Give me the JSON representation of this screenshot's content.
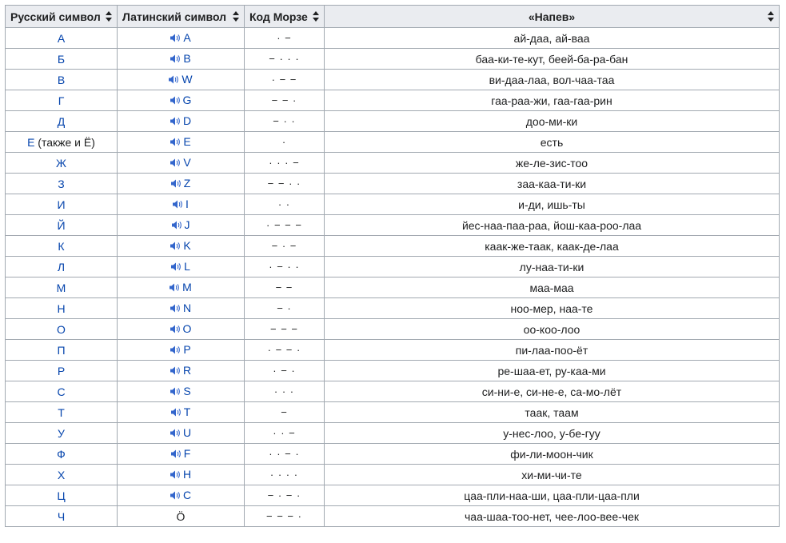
{
  "table": {
    "headers": [
      "Русский символ",
      "Латинский символ",
      "Код Морзе",
      "«Напев»"
    ],
    "rows": [
      {
        "ru": "А",
        "ru_extra": "",
        "lat": "A",
        "audio": true,
        "morse": "· −",
        "chant": "ай-даа, ай-ваа"
      },
      {
        "ru": "Б",
        "ru_extra": "",
        "lat": "B",
        "audio": true,
        "morse": "− · · ·",
        "chant": "баа-ки-те-кут, беей-ба-ра-бан"
      },
      {
        "ru": "В",
        "ru_extra": "",
        "lat": "W",
        "audio": true,
        "morse": "· − −",
        "chant": "ви-даа-лаа, вол-чаа-таа"
      },
      {
        "ru": "Г",
        "ru_extra": "",
        "lat": "G",
        "audio": true,
        "morse": "− − ·",
        "chant": "гаа-раа-жи, гаа-гаа-рин"
      },
      {
        "ru": "Д",
        "ru_extra": "",
        "lat": "D",
        "audio": true,
        "morse": "− · ·",
        "chant": "доо-ми-ки"
      },
      {
        "ru": "Е",
        "ru_extra": " (также и Ё)",
        "lat": "E",
        "audio": true,
        "morse": "·",
        "chant": "есть"
      },
      {
        "ru": "Ж",
        "ru_extra": "",
        "lat": "V",
        "audio": true,
        "morse": "· · · −",
        "chant": "же-ле-зис-тоо"
      },
      {
        "ru": "З",
        "ru_extra": "",
        "lat": "Z",
        "audio": true,
        "morse": "− − · ·",
        "chant": "заа-каа-ти-ки"
      },
      {
        "ru": "И",
        "ru_extra": "",
        "lat": "I",
        "audio": true,
        "morse": "· ·",
        "chant": "и-ди, ишь-ты"
      },
      {
        "ru": "Й",
        "ru_extra": "",
        "lat": "J",
        "audio": true,
        "morse": "· − − −",
        "chant": "йес-наа-паа-раа, йош-каа-роо-лаа"
      },
      {
        "ru": "К",
        "ru_extra": "",
        "lat": "K",
        "audio": true,
        "morse": "− · −",
        "chant": "каак-же-таак, каак-де-лаа"
      },
      {
        "ru": "Л",
        "ru_extra": "",
        "lat": "L",
        "audio": true,
        "morse": "· − · ·",
        "chant": "лу-наа-ти-ки"
      },
      {
        "ru": "М",
        "ru_extra": "",
        "lat": "M",
        "audio": true,
        "morse": "− −",
        "chant": "маа-маа"
      },
      {
        "ru": "Н",
        "ru_extra": "",
        "lat": "N",
        "audio": true,
        "morse": "− ·",
        "chant": "ноо-мер, наа-те"
      },
      {
        "ru": "О",
        "ru_extra": "",
        "lat": "O",
        "audio": true,
        "morse": "− − −",
        "chant": "оо-коо-лоо"
      },
      {
        "ru": "П",
        "ru_extra": "",
        "lat": "P",
        "audio": true,
        "morse": "· − − ·",
        "chant": "пи-лаа-поо-ёт"
      },
      {
        "ru": "Р",
        "ru_extra": "",
        "lat": "R",
        "audio": true,
        "morse": "· − ·",
        "chant": "ре-шаа-ет, ру-каа-ми"
      },
      {
        "ru": "С",
        "ru_extra": "",
        "lat": "S",
        "audio": true,
        "morse": "· · ·",
        "chant": "си-ни-е, си-не-е, са-мо-лёт"
      },
      {
        "ru": "Т",
        "ru_extra": "",
        "lat": "T",
        "audio": true,
        "morse": "−",
        "chant": "таак, таам"
      },
      {
        "ru": "У",
        "ru_extra": "",
        "lat": "U",
        "audio": true,
        "morse": "· · −",
        "chant": "у-нес-лоо, у-бе-гуу"
      },
      {
        "ru": "Ф",
        "ru_extra": "",
        "lat": "F",
        "audio": true,
        "morse": "· · − ·",
        "chant": "фи-ли-моон-чик"
      },
      {
        "ru": "Х",
        "ru_extra": "",
        "lat": "H",
        "audio": true,
        "morse": "· · · ·",
        "chant": "хи-ми-чи-те"
      },
      {
        "ru": "Ц",
        "ru_extra": "",
        "lat": "C",
        "audio": true,
        "morse": "− · − ·",
        "chant": "цаа-пли-наа-ши, цаа-пли-цаа-пли"
      },
      {
        "ru": "Ч",
        "ru_extra": "",
        "lat": "Ö",
        "audio": false,
        "morse": "− − − ·",
        "chant": "чаа-шаа-тоо-нет, чее-лоо-вее-чек"
      }
    ]
  },
  "colors": {
    "link": "#0645ad",
    "header_bg": "#eaecf0",
    "border": "#a2a9b1"
  },
  "icons": {
    "audio": "speaker-icon",
    "sort": "sort-icon"
  }
}
